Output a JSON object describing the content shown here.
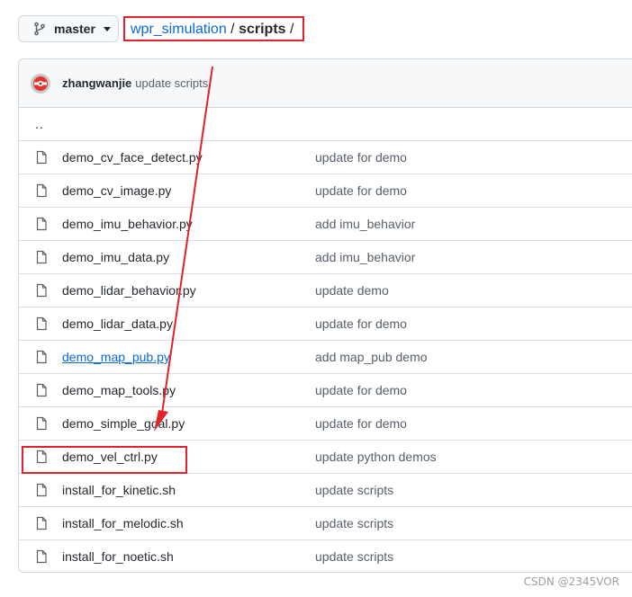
{
  "branch": {
    "label": "master",
    "icon": "git-branch-icon"
  },
  "breadcrumb": {
    "repo": "wpr_simulation",
    "separator": "/",
    "current": "scripts"
  },
  "commit": {
    "author": "zhangwanjie",
    "message": "update scripts",
    "avatar_icon": "avatar"
  },
  "parent_dir": "..",
  "files": [
    {
      "name": "demo_cv_face_detect.py",
      "message": "update for demo"
    },
    {
      "name": "demo_cv_image.py",
      "message": "update for demo"
    },
    {
      "name": "demo_imu_behavior.py",
      "message": "add imu_behavior"
    },
    {
      "name": "demo_imu_data.py",
      "message": "add imu_behavior"
    },
    {
      "name": "demo_lidar_behavior.py",
      "message": "update demo"
    },
    {
      "name": "demo_lidar_data.py",
      "message": "update for demo"
    },
    {
      "name": "demo_map_pub.py",
      "message": "add map_pub demo"
    },
    {
      "name": "demo_map_tools.py",
      "message": "update for demo"
    },
    {
      "name": "demo_simple_goal.py",
      "message": "update for demo"
    },
    {
      "name": "demo_vel_ctrl.py",
      "message": "update python demos"
    },
    {
      "name": "install_for_kinetic.sh",
      "message": "update scripts"
    },
    {
      "name": "install_for_melodic.sh",
      "message": "update scripts"
    },
    {
      "name": "install_for_noetic.sh",
      "message": "update scripts"
    }
  ],
  "annotation_color": "#e1222c",
  "watermark": "CSDN @2345VOR"
}
